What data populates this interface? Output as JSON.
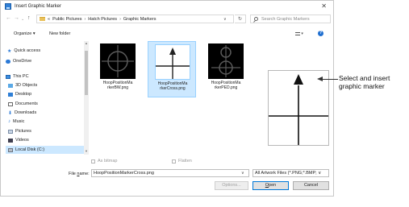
{
  "window": {
    "title": "Insert Graphic Marker",
    "close_glyph": "✕"
  },
  "address": {
    "back_glyph": "←",
    "forward_glyph": "→",
    "recent_glyph": "⌄",
    "up_glyph": "↑",
    "prefix": "«",
    "crumbs": [
      "Public Pictures",
      "Hatch Pictures",
      "Graphic Markers"
    ],
    "separator": "›",
    "dropdown_glyph": "∨",
    "refresh_glyph": "↻",
    "search_placeholder": "Search Graphic Markers"
  },
  "toolbar": {
    "organize": "Organize ▾",
    "new_folder": "New folder",
    "view_glyph": "▾",
    "help_glyph": "?"
  },
  "nav": {
    "items": [
      {
        "label": "Quick access",
        "icon": "star-icon"
      },
      {
        "label": "OneDrive",
        "icon": "cloud-icon"
      },
      {
        "label": "This PC",
        "icon": "computer-icon"
      },
      {
        "label": "3D Objects",
        "icon": "cube-icon"
      },
      {
        "label": "Desktop",
        "icon": "desktop-icon"
      },
      {
        "label": "Documents",
        "icon": "document-icon"
      },
      {
        "label": "Downloads",
        "icon": "download-icon"
      },
      {
        "label": "Music",
        "icon": "music-icon"
      },
      {
        "label": "Pictures",
        "icon": "pictures-icon"
      },
      {
        "label": "Videos",
        "icon": "video-icon"
      },
      {
        "label": "Local Disk (C:)",
        "icon": "disk-icon"
      }
    ],
    "selected_index": 10,
    "scroll_up": "▲",
    "scroll_down": "▼"
  },
  "files": [
    {
      "label": "HoopPositionMa\nrkerBW.png",
      "selected": false,
      "kind": "circle-cross"
    },
    {
      "label": "HoopPositionMa\nrkerCross.png",
      "selected": true,
      "kind": "arrow-cross"
    },
    {
      "label": "HoopPositionMa\nrkerPED.png",
      "selected": false,
      "kind": "ped"
    }
  ],
  "options": {
    "as_bitmap": "As bitmap",
    "flatten": "Flatten"
  },
  "file_name": {
    "label_pre": "File ",
    "label_underlined": "n",
    "label_post": "ame:",
    "value": "HoopPositionMarkerCross.png",
    "dropdown_glyph": "∨"
  },
  "filter": {
    "value": "All Artwork Files (*.PNG;*.BMP;",
    "dropdown_glyph": "∨"
  },
  "buttons": {
    "options": "Options...",
    "open_underlined": "O",
    "open_rest": "pen",
    "cancel": "Cancel"
  },
  "callout": {
    "text": "Select and insert\ngraphic marker"
  },
  "colors": {
    "selection": "#cce8ff",
    "accent": "#0078d7"
  }
}
